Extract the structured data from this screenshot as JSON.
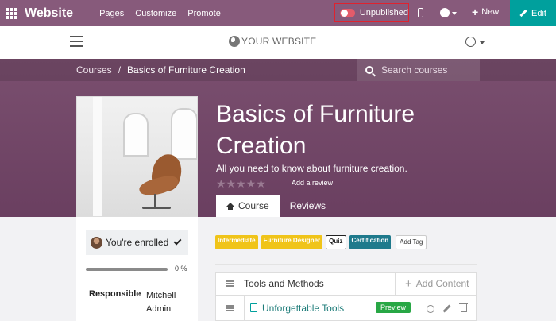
{
  "topbar": {
    "brand": "Website",
    "menu": [
      "Pages",
      "Customize",
      "Promote"
    ],
    "publish_status": "Unpublished",
    "new_label": "New",
    "new_plus": "+",
    "edit_label": "Edit",
    "colors": {
      "bar": "#875a7b",
      "edit": "#00a09d",
      "highlight": "#e0222e"
    }
  },
  "site_header": {
    "logo_text": "YOUR WEBSITE"
  },
  "breadcrumb": {
    "parent": "Courses",
    "separator": "/",
    "current": "Basics of Furniture Creation"
  },
  "search": {
    "placeholder": "Search courses"
  },
  "course": {
    "title": "Basics of Furniture Creation",
    "description": "All you need to know about furniture creation.",
    "rating_stars": "★★★★★",
    "add_review": "Add a review"
  },
  "tabs": [
    {
      "label": "Course",
      "icon": "home-icon",
      "active": true
    },
    {
      "label": "Reviews",
      "active": false
    }
  ],
  "sidebar": {
    "enrolled_text": "You're enrolled",
    "progress_percent": 0,
    "progress_label": "0 %",
    "responsible_label": "Responsible",
    "responsible_value": "Mitchell Admin"
  },
  "tags": [
    {
      "label": "Intermediate",
      "bg": "#f0c419",
      "fg": "#fff"
    },
    {
      "label": "Furniture Designer",
      "bg": "#f0c419",
      "fg": "#fff"
    },
    {
      "label": "Quiz",
      "bg": "#fff",
      "fg": "#222",
      "border": "#222"
    },
    {
      "label": "Certification",
      "bg": "#1f7a8c",
      "fg": "#fff"
    }
  ],
  "add_tag_label": "Add Tag",
  "sections": [
    {
      "title": "Tools and Methods",
      "add_content_plus": "+",
      "add_content_label": "Add Content",
      "lessons": [
        {
          "title": "Unforgettable Tools",
          "badge": "Preview"
        }
      ]
    }
  ]
}
